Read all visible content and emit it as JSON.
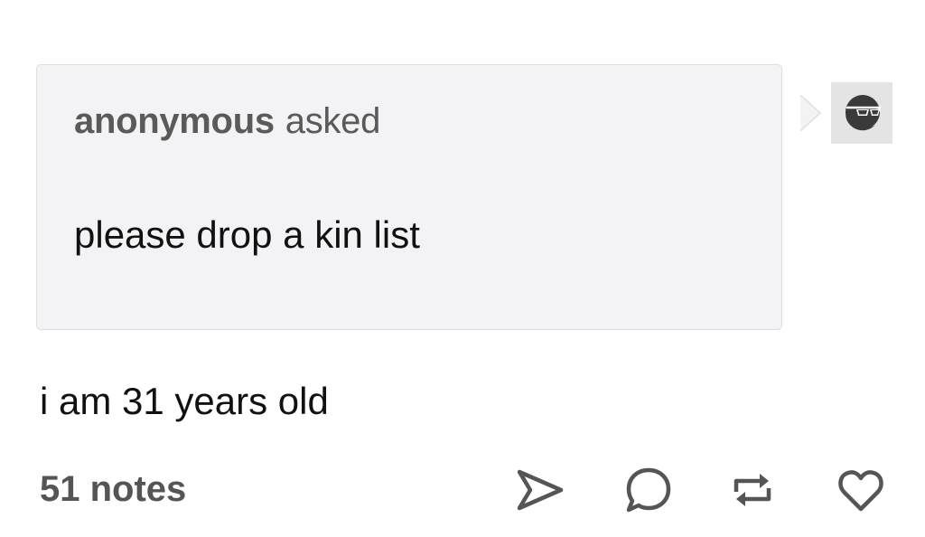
{
  "ask": {
    "asker": "anonymous",
    "verb": "asked",
    "question": "please drop a kin list"
  },
  "answer": {
    "text": "i am 31 years old"
  },
  "footer": {
    "notes": "51 notes",
    "actions": [
      "share-icon",
      "reply-icon",
      "reblog-icon",
      "heart-icon"
    ]
  },
  "avatar": {
    "icon": "sunglasses-face-icon"
  },
  "colors": {
    "ask_background": "#f3f2f4",
    "ask_border": "#dedde0",
    "muted_text": "#5a5a5a",
    "icon_stroke": "#555555"
  }
}
